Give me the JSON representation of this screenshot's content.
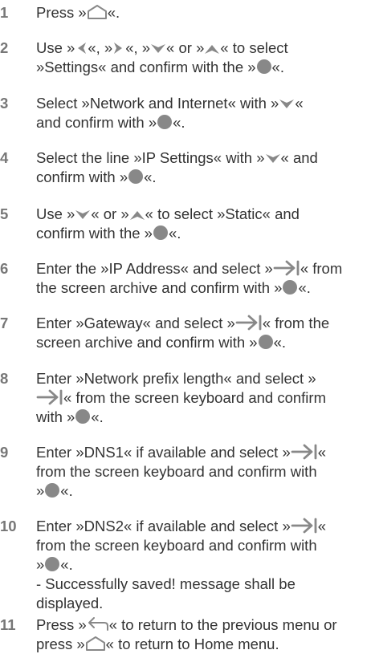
{
  "icons": {
    "home": "home-icon",
    "left": "arrow-left-icon",
    "right": "arrow-right-icon",
    "down": "arrow-down-icon",
    "up": "arrow-up-icon",
    "ok": "ok-dot-icon",
    "tab": "tab-arrow-icon",
    "back": "back-arrow-icon"
  },
  "colors": {
    "text": "#333333",
    "number": "#777777",
    "icon": "#888888"
  },
  "steps": [
    {
      "number": "1",
      "segments": [
        [
          "Press »",
          "home",
          "«."
        ]
      ]
    },
    {
      "number": "2",
      "segments": [
        [
          "Use »",
          "left",
          "«, »",
          "right",
          "«, »",
          "down",
          "« or »",
          "up",
          "« to select"
        ],
        [
          "»Settings« and confirm with the »",
          "ok",
          "«."
        ]
      ]
    },
    {
      "number": "3",
      "segments": [
        [
          "Select »Network and Internet« with »",
          "down",
          "«"
        ],
        [
          "and confirm with »",
          "ok",
          "«."
        ]
      ]
    },
    {
      "number": "4",
      "segments": [
        [
          "Select the line »IP Settings« with »",
          "down",
          "« and"
        ],
        [
          "confirm with »",
          "ok",
          "«."
        ]
      ]
    },
    {
      "number": "5",
      "segments": [
        [
          "Use »",
          "down",
          "« or »",
          "up",
          "« to select »Static« and"
        ],
        [
          "confirm with the »",
          "ok",
          "«."
        ]
      ]
    },
    {
      "number": "6",
      "segments": [
        [
          "Enter the »IP Address« and select »",
          "tab",
          "« from"
        ],
        [
          "the screen archive and confirm with »",
          "ok",
          "«."
        ]
      ]
    },
    {
      "number": "7",
      "segments": [
        [
          "Enter »Gateway« and select »",
          "tab",
          "« from the"
        ],
        [
          "screen archive and confirm with »",
          "ok",
          "«."
        ]
      ]
    },
    {
      "number": "8",
      "segments": [
        [
          "Enter »Network prefix length« and select »"
        ],
        [
          "tab",
          "« from the screen keyboard and confirm"
        ],
        [
          "with »",
          "ok",
          "«."
        ]
      ]
    },
    {
      "number": "9",
      "segments": [
        [
          "Enter »DNS1« if available and select »",
          "tab",
          "«"
        ],
        [
          "from the screen keyboard and confirm with"
        ],
        [
          "»",
          "ok",
          "«."
        ]
      ]
    },
    {
      "number": "10",
      "segments": [
        [
          "Enter »DNS2« if available and select »",
          "tab",
          "«"
        ],
        [
          "from the screen keyboard and confirm with"
        ],
        [
          "»",
          "ok",
          "«."
        ],
        [
          "- Successfully saved! message shall be"
        ],
        [
          "displayed."
        ]
      ]
    },
    {
      "number": "11",
      "segments": [
        [
          "Press »",
          "back",
          "« to return to the previous menu or"
        ],
        [
          "press »",
          "home",
          "« to return to Home menu."
        ]
      ]
    }
  ]
}
